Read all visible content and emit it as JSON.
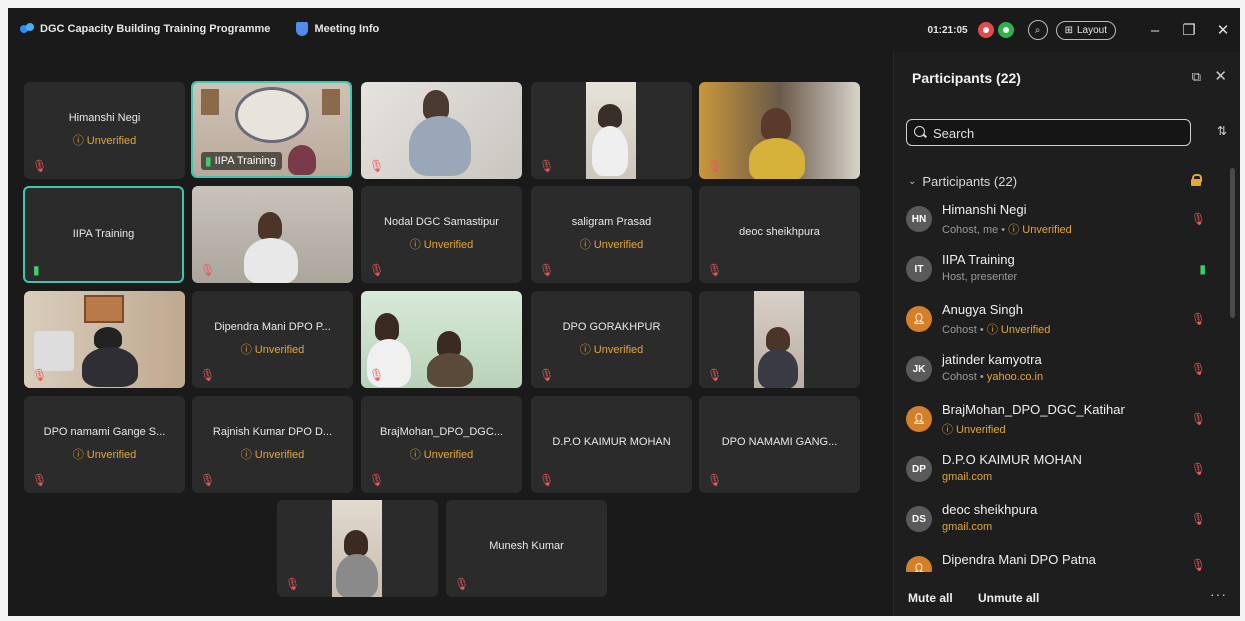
{
  "titlebar": {
    "app_title": "DGC Capacity Building Training Programme",
    "meeting_info": "Meeting Info",
    "timer": "01:21:05",
    "layout_label": "Layout",
    "minimize": "–",
    "restore": "❐",
    "close": "✕"
  },
  "colors": {
    "accent_teal": "#3cc7b0",
    "unverified_orange": "#e2a63a",
    "mic_red": "#e85a5a",
    "mic_green": "#3ccf6a"
  },
  "tiles": {
    "t1": {
      "name": "Himanshi Negi",
      "status": "ⓘ Unverified"
    },
    "t2": {
      "name": "IIPA Training"
    },
    "t6": {
      "name": "IIPA Training"
    },
    "t8": {
      "name": "Nodal DGC Samastipur",
      "status": "ⓘ Unverified"
    },
    "t9": {
      "name": "saligram Prasad",
      "status": "ⓘ Unverified"
    },
    "t10": {
      "name": "deoc sheikhpura"
    },
    "t12": {
      "name": "Dipendra Mani DPO P...",
      "status": "ⓘ Unverified"
    },
    "t14": {
      "name": "DPO GORAKHPUR",
      "status": "ⓘ Unverified"
    },
    "t16": {
      "name": "DPO namami Gange S...",
      "status": "ⓘ Unverified"
    },
    "t17": {
      "name": "Rajnish Kumar DPO D...",
      "status": "ⓘ Unverified"
    },
    "t18": {
      "name": "BrajMohan_DPO_DGC...",
      "status": "ⓘ Unverified"
    },
    "t19": {
      "name": "D.P.O KAIMUR MOHAN"
    },
    "t20": {
      "name": "DPO NAMAMI GANG..."
    },
    "t22": {
      "name": "Munesh Kumar"
    }
  },
  "panel": {
    "title": "Participants (22)",
    "search_placeholder": "Search",
    "section_label": "Participants (22)",
    "participants": [
      {
        "initials": "HN",
        "name": "Himanshi Negi",
        "role": "Cohost, me • ",
        "status": "ⓘ Unverified"
      },
      {
        "initials": "IT",
        "name": "IIPA Training",
        "role": "Host, presenter",
        "status": ""
      },
      {
        "initials": "",
        "name": "Anugya Singh",
        "role": "Cohost • ",
        "status": "ⓘ Unverified"
      },
      {
        "initials": "JK",
        "name": "jatinder kamyotra",
        "role": "Cohost • ",
        "status": "yahoo.co.in"
      },
      {
        "initials": "",
        "name": "BrajMohan_DPO_DGC_Katihar",
        "role": "",
        "status": "ⓘ Unverified"
      },
      {
        "initials": "DP",
        "name": "D.P.O KAIMUR MOHAN",
        "role": "",
        "status": "gmail.com"
      },
      {
        "initials": "DS",
        "name": "deoc sheikhpura",
        "role": "",
        "status": "gmail.com"
      },
      {
        "initials": "",
        "name": "Dipendra Mani DPO Patna",
        "role": "",
        "status": ""
      }
    ],
    "mute_all": "Mute all",
    "unmute_all": "Unmute all",
    "more": "···"
  }
}
